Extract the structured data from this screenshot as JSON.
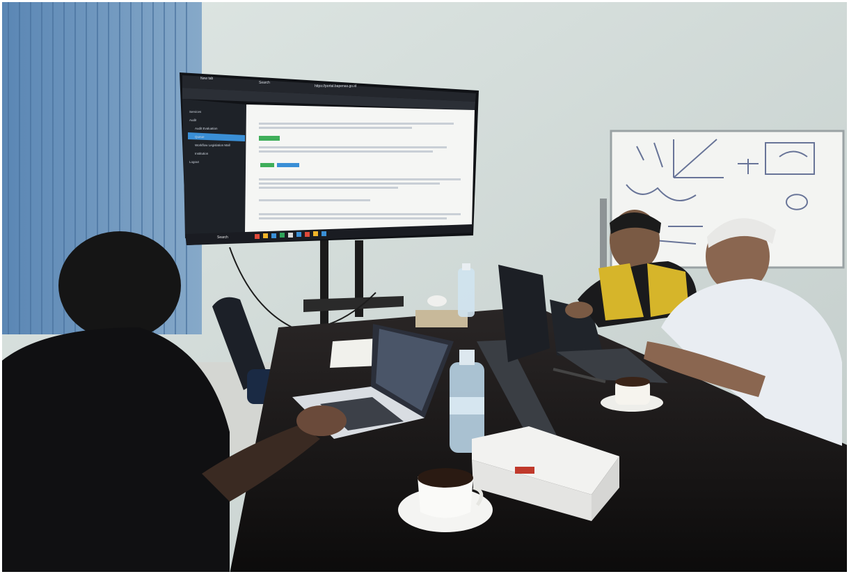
{
  "scene": {
    "colors": {
      "wall": "#cfd8d6",
      "blinds": "#6b92b8",
      "table": "#1a1818",
      "monitor_bezel": "#101216",
      "screen_sidebar": "#1e2228",
      "screen_content": "#f5f6f4",
      "accent_green": "#3fae5a",
      "accent_blue": "#3a8fd6",
      "vest": "#d6b52a",
      "shirt": "#e9edf2"
    }
  },
  "monitor": {
    "browser_tabs": [
      "New tab",
      "Search",
      "https://portal.bapenas.go.id"
    ],
    "sidebar_items": [
      "Services",
      "Audit",
      "Audit Evaluation",
      "Queue",
      "Workflow Legislation Mall",
      "Institution",
      "Logout"
    ],
    "taskbar_search": "Search"
  }
}
